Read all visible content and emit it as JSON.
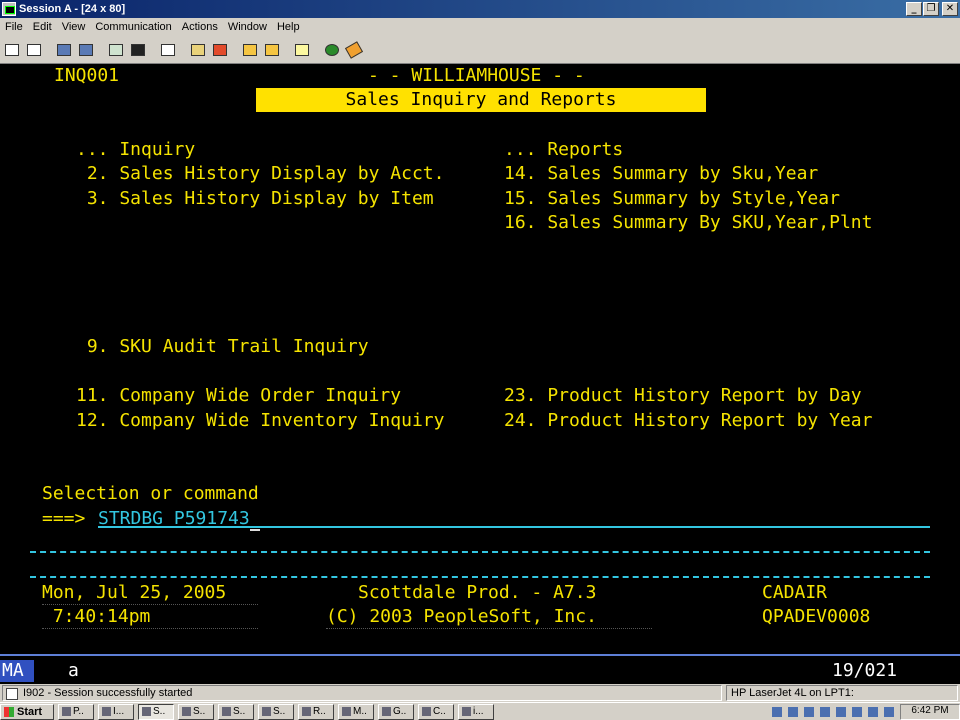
{
  "window": {
    "title": "Session A - [24 x 80]",
    "minimize_glyph": "_",
    "restore_glyph": "❐",
    "close_glyph": "✕"
  },
  "menu": [
    "File",
    "Edit",
    "View",
    "Communication",
    "Actions",
    "Window",
    "Help"
  ],
  "toolbar": {
    "icons": [
      "print-screen-icon",
      "copy-icon",
      "send-file-icon",
      "receive-file-icon",
      "display-icon",
      "keypad-icon",
      "printer-icon",
      "macro-play-icon",
      "macro-record-icon",
      "macro-stop-icon",
      "macro-edit-icon",
      "clipboard-icon",
      "globe-icon",
      "help-icon"
    ]
  },
  "terminal": {
    "program_id": "INQ001",
    "company": "- - WILLIAMHOUSE - -",
    "banner": "Sales Inquiry and Reports",
    "inquiry_header": "... Inquiry",
    "reports_header": "... Reports",
    "left_options": [
      " 2. Sales History Display by Acct.",
      " 3. Sales History Display by Item",
      " 9. SKU Audit Trail Inquiry",
      "11. Company Wide Order Inquiry",
      "12. Company Wide Inventory Inquiry"
    ],
    "right_options": [
      "14. Sales Summary by Sku,Year",
      "15. Sales Summary by Style,Year",
      "16. Sales Summary By SKU,Year,Plnt",
      "23. Product History Report by Day",
      "24. Product History Report by Year"
    ],
    "prompt_label": "Selection or command",
    "prompt_arrow": "===>",
    "command_value": "STRDBG P591743",
    "date": "Mon, Jul 25, 2005",
    "time": " 7:40:14pm",
    "system": "Scottdale Prod. - A7.3",
    "copyright": "(C) 2003 PeopleSoft, Inc.",
    "user": "CADAIR",
    "device": "QPADEV0008"
  },
  "oia": {
    "mode": "MA",
    "indicator": "a",
    "cursor_position": "19/021"
  },
  "status": {
    "message": "I902 - Session successfully started",
    "printer": "HP LaserJet 4L on LPT1:"
  },
  "taskbar": {
    "start_label": "Start",
    "tasks": [
      "P..",
      "I...",
      "S..",
      "S..",
      "S..",
      "S..",
      "R..",
      "M..",
      "G..",
      "C..",
      "i..."
    ],
    "clock": "6:42 PM"
  }
}
